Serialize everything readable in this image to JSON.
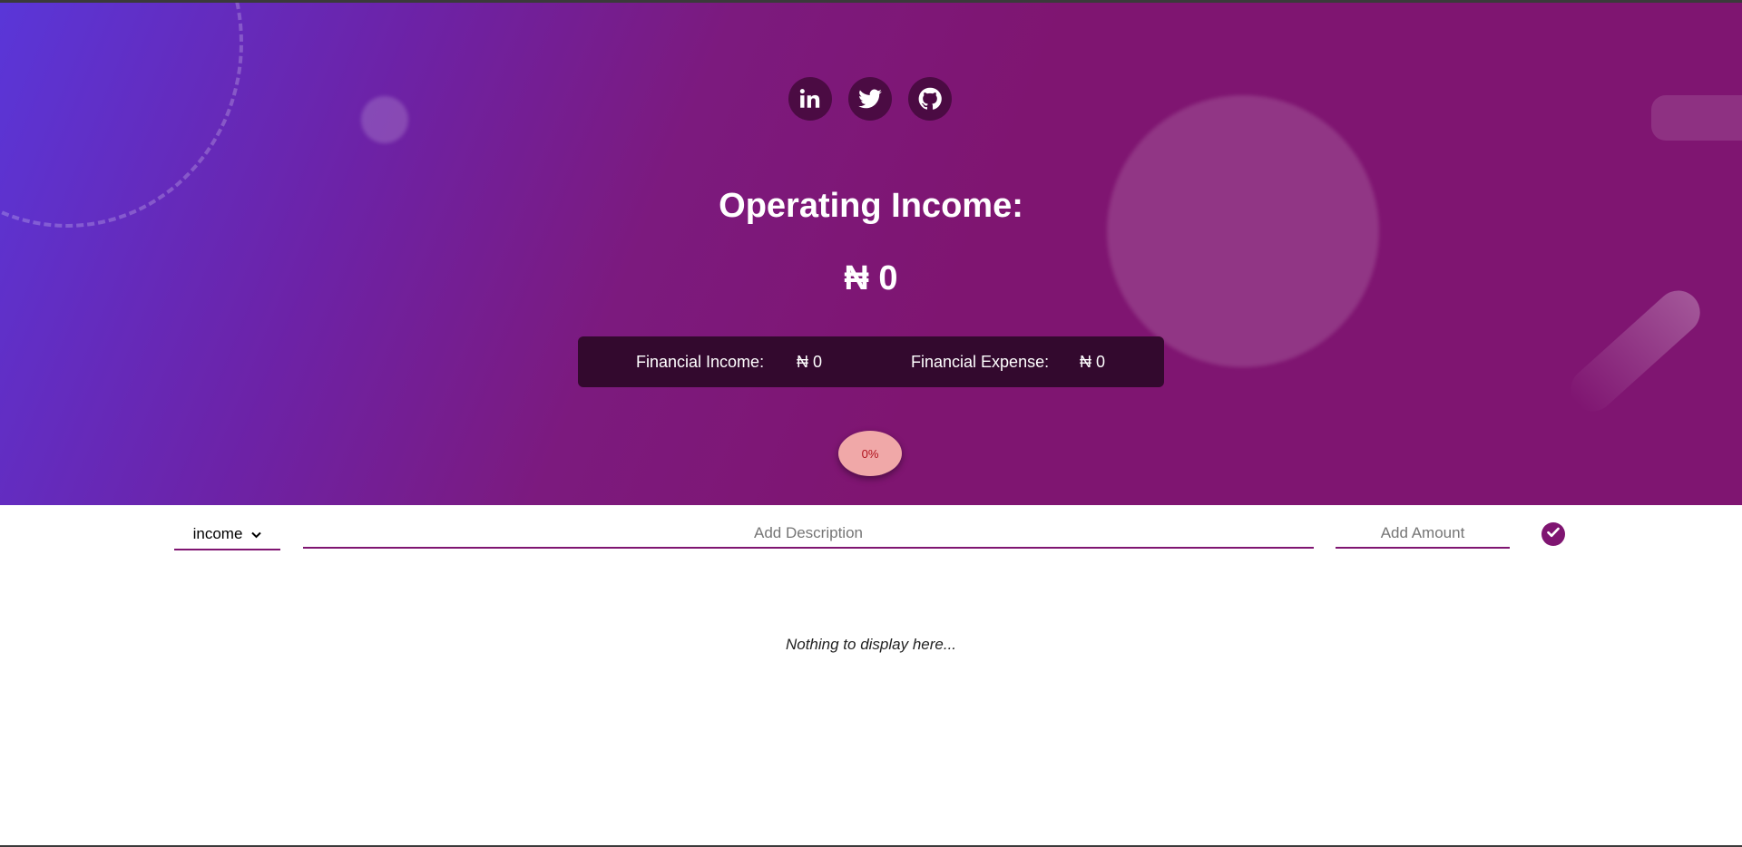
{
  "header": {
    "socials": [
      {
        "name": "linkedin-icon"
      },
      {
        "name": "twitter-icon"
      },
      {
        "name": "github-icon"
      }
    ],
    "operating_income_label": "Operating Income:",
    "operating_income_value": "₦ 0",
    "financial_income_label": "Financial Income:",
    "financial_income_value": "₦ 0",
    "financial_expense_label": "Financial Expense:",
    "financial_expense_value": "₦ 0",
    "percentage": "0%"
  },
  "form": {
    "type_selected": "income",
    "description_placeholder": "Add Description",
    "amount_placeholder": "Add Amount"
  },
  "list": {
    "empty_message": "Nothing to display here..."
  },
  "colors": {
    "accent": "#7f1571",
    "panel": "#33092e",
    "social_bg": "#4b0b43",
    "percent_bg": "#f0a8a8",
    "percent_text": "#b0121e"
  }
}
